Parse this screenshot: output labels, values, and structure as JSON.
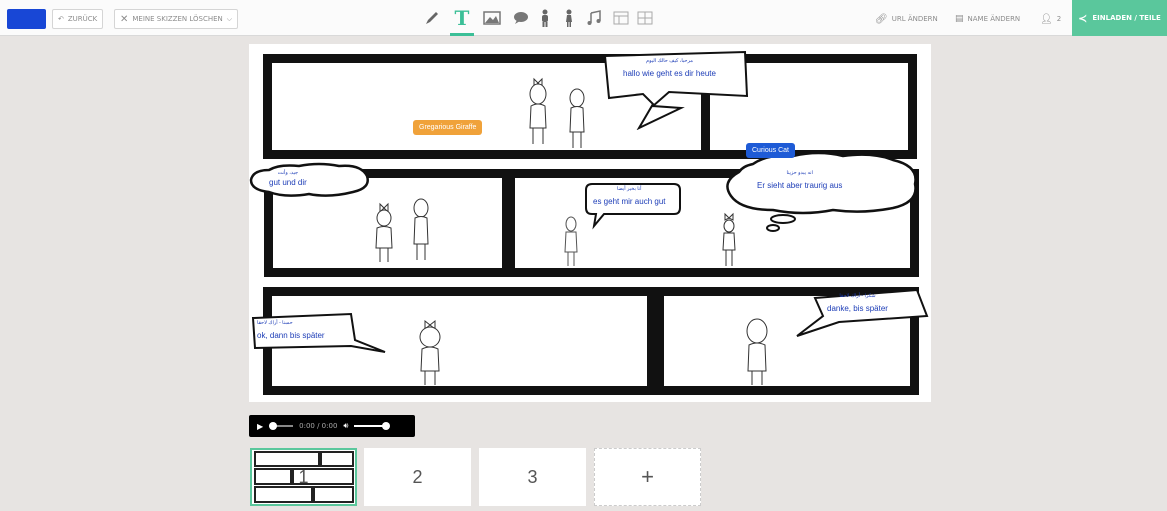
{
  "toolbar": {
    "accent_color": "#1847d6",
    "undo_label": "ZURÜCK",
    "delete_label": "MEINE SKIZZEN LÖSCHEN",
    "tools": [
      "pencil-icon",
      "text-icon",
      "image-icon",
      "speech-bubble-icon",
      "character-icon",
      "character-female-icon",
      "music-icon",
      "layout-icon",
      "panel-icon"
    ],
    "url_label": "URL ÄNDERN",
    "name_label": "NAME ÄNDERN",
    "user_count": "2",
    "invite_label": "EINLADEN / TEILE",
    "invite_color": "#5ac79c"
  },
  "comic": {
    "users": [
      {
        "name": "Gregarious Giraffe",
        "color": "#f0a23a"
      },
      {
        "name": "Curious Cat",
        "color": "#1e5bd6"
      }
    ],
    "bubbles": [
      {
        "arabic": "مرحبا، كيف حالك اليوم",
        "text": "hallo wie geht es dir heute"
      },
      {
        "arabic": "جيد، وأنت",
        "text": "gut und dir"
      },
      {
        "arabic": "أنا بخير أيضا",
        "text": "es geht mir auch gut"
      },
      {
        "arabic": "انه يبدو حزينا",
        "text": "Er sieht aber traurig aus"
      },
      {
        "arabic": "حسنا - أراك لاحقا",
        "text": "ok, dann bis später"
      },
      {
        "arabic": "شكرا - أراك لاحقا",
        "text": "danke, bis später"
      }
    ]
  },
  "audio": {
    "time": "0:00 / 0:00"
  },
  "pages": [
    "1",
    "2",
    "3",
    "+"
  ]
}
